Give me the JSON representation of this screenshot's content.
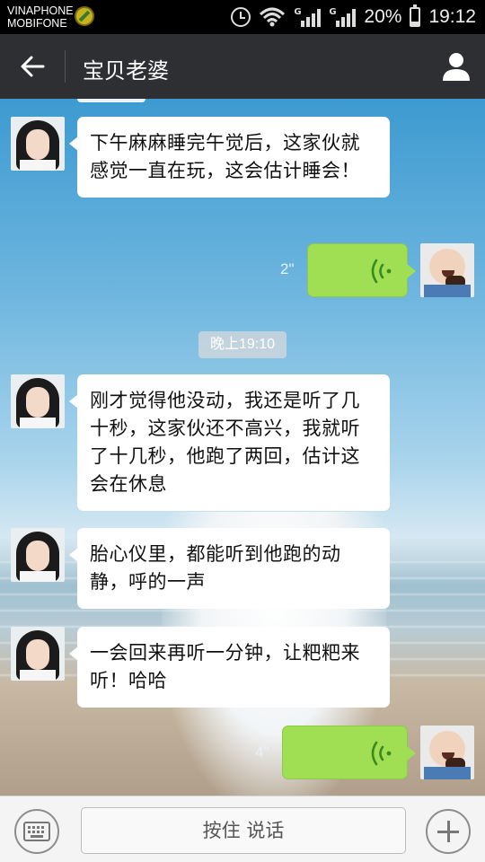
{
  "status_bar": {
    "carrier_1": "VINAPHONE",
    "carrier_2": "MOBIFONE",
    "network_1": "G",
    "network_2": "G",
    "battery": "20%",
    "time": "19:12"
  },
  "header": {
    "title": "宝贝老婆"
  },
  "chat": {
    "time_separator": "晚上19:10",
    "messages": [
      {
        "sender": "her",
        "type": "text",
        "text": "下午麻麻睡完午觉后，这家伙就感觉一直在玩，这会估计睡会！"
      },
      {
        "sender": "me",
        "type": "voice",
        "duration": "2\""
      },
      {
        "sender": "her",
        "type": "text",
        "text": "刚才觉得他没动，我还是听了几十秒，这家伙还不高兴，我就听了十几秒，他跑了两回，估计这会在休息"
      },
      {
        "sender": "her",
        "type": "text",
        "text": "胎心仪里，都能听到他跑的动静，呼的一声"
      },
      {
        "sender": "her",
        "type": "text",
        "text": "一会回来再听一分钟，让粑粑来听！哈哈"
      },
      {
        "sender": "me",
        "type": "voice",
        "duration": "4\""
      }
    ]
  },
  "bottom_bar": {
    "hold_to_talk": "按住 说话"
  },
  "colors": {
    "header_bg": "#2d2f33",
    "voice_bubble": "#a0df54",
    "text_bubble": "#ffffff"
  }
}
